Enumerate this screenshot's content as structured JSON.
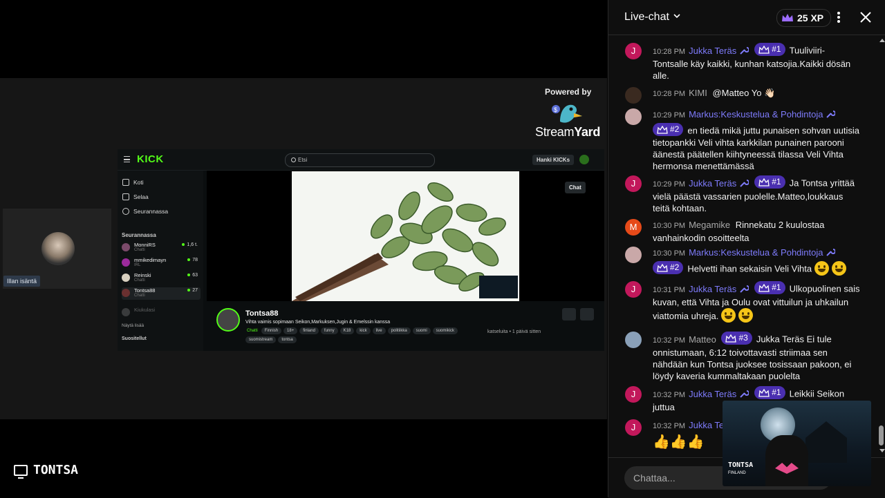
{
  "stream": {
    "powered_by": "Powered by",
    "streamyard_a": "Stream",
    "streamyard_b": "Yard",
    "cam_label": "Illan isäntä",
    "channel_brand": "TONTSA"
  },
  "kick": {
    "logo": "KICK",
    "search_placeholder": "Etsi",
    "get_kicks": "Hanki KICKs",
    "nav": [
      "Koti",
      "Selaa",
      "Seurannassa"
    ],
    "following_header": "Seurannassa",
    "following": [
      {
        "name": "MonniRS",
        "sub": "Chatti",
        "count": "1,6 t."
      },
      {
        "name": "mmikedimayn",
        "sub": "IRL",
        "count": "78"
      },
      {
        "name": "Reinski",
        "sub": "Chatti",
        "count": "63"
      },
      {
        "name": "Tontsa88",
        "sub": "Chatti",
        "count": "27"
      },
      {
        "name": "Kiukulasi",
        "sub": "",
        "count": ""
      }
    ],
    "show_more": "Näytä lisää",
    "recommended": "Suositellut",
    "chat_button": "Chat",
    "channel_name": "Tontsa88",
    "stream_title": "Vihta vaimis sopimaan Seikon,Markuksen,Jugin & Emelssin kanssa",
    "category": "Chatti",
    "tags": [
      "Finnish",
      "18+",
      "finland",
      "funny",
      "K18",
      "kick",
      "live",
      "politiikka",
      "suomi",
      "suomikick",
      "suomistream",
      "tontsa"
    ],
    "meta_watch": "katseluita",
    "meta_time": "1 päivä sitten"
  },
  "chat": {
    "title": "Live-chat",
    "xp": "25 XP",
    "input_placeholder": "Chattaa...",
    "messages": [
      {
        "time": "10:28 PM",
        "author": "Jukka Teräs",
        "mod": true,
        "badge": "#1",
        "avatar": "J",
        "avatar_color": "#c2185b",
        "text": "Tuuliviiri-Tontsalle käy kaikki, kunhan katsojia.Kaikki dösän alle."
      },
      {
        "time": "10:28 PM",
        "author": "KIMI",
        "mod": false,
        "badge": "",
        "avatar": "",
        "avatar_color": "#3a2a20",
        "text": "@Matteo Yo 👋🏻"
      },
      {
        "time": "10:29 PM",
        "author": "Markus:Keskustelua & Pohdintoja",
        "mod": true,
        "badge": "#2",
        "avatar": "",
        "avatar_color": "#c9a8a8",
        "text": "en tiedä mikä juttu punaisen sohvan uutisia tietopankki Veli vihta karkkilan punainen parooni äänestä päätellen kiihtyneessä tilassa Veli Vihta hermonsa menettämässä"
      },
      {
        "time": "10:29 PM",
        "author": "Jukka Teräs",
        "mod": true,
        "badge": "#1",
        "avatar": "J",
        "avatar_color": "#c2185b",
        "text": "Ja Tontsa yrittää vielä päästä vassarien puolelle.Matteo,loukkaus teitä kohtaan."
      },
      {
        "time": "10:30 PM",
        "author": "Megamike",
        "mod": false,
        "badge": "",
        "avatar": "M",
        "avatar_color": "#e64a19",
        "text": "Rinnekatu 2 kuulostaa vanhainkodin osoitteelta"
      },
      {
        "time": "10:30 PM",
        "author": "Markus:Keskustelua & Pohdintoja",
        "mod": true,
        "badge": "#2",
        "avatar": "",
        "avatar_color": "#c9a8a8",
        "text": "Helvetti ihan sekaisin Veli Vihta"
      },
      {
        "time": "10:31 PM",
        "author": "Jukka Teräs",
        "mod": true,
        "badge": "#1",
        "avatar": "J",
        "avatar_color": "#c2185b",
        "text": "Ulkopuolinen sais kuvan, että Vihta ja Oulu ovat vittuilun ja uhkailun viattomia uhreja."
      },
      {
        "time": "10:32 PM",
        "author": "Matteo",
        "mod": false,
        "badge": "#3",
        "avatar": "",
        "avatar_color": "#8aa0b8",
        "text": "Jukka Teräs Ei tule onnistumaan, 6:12 toivottavasti striimaa sen nähdään kun Tontsa juoksee tosissaan pakoon, ei löydy kaveria kummaltakaan puolelta"
      },
      {
        "time": "10:32 PM",
        "author": "Jukka Teräs",
        "mod": true,
        "badge": "#1",
        "avatar": "J",
        "avatar_color": "#c2185b",
        "text": "Leikkii Seikon juttua"
      },
      {
        "time": "10:32 PM",
        "author": "Jukka Teräs",
        "mod": true,
        "badge": "",
        "avatar": "J",
        "avatar_color": "#c2185b",
        "text": "👍👍👍"
      }
    ]
  },
  "webcam": {
    "name": "TONTSA",
    "sub": "FINLAND"
  }
}
